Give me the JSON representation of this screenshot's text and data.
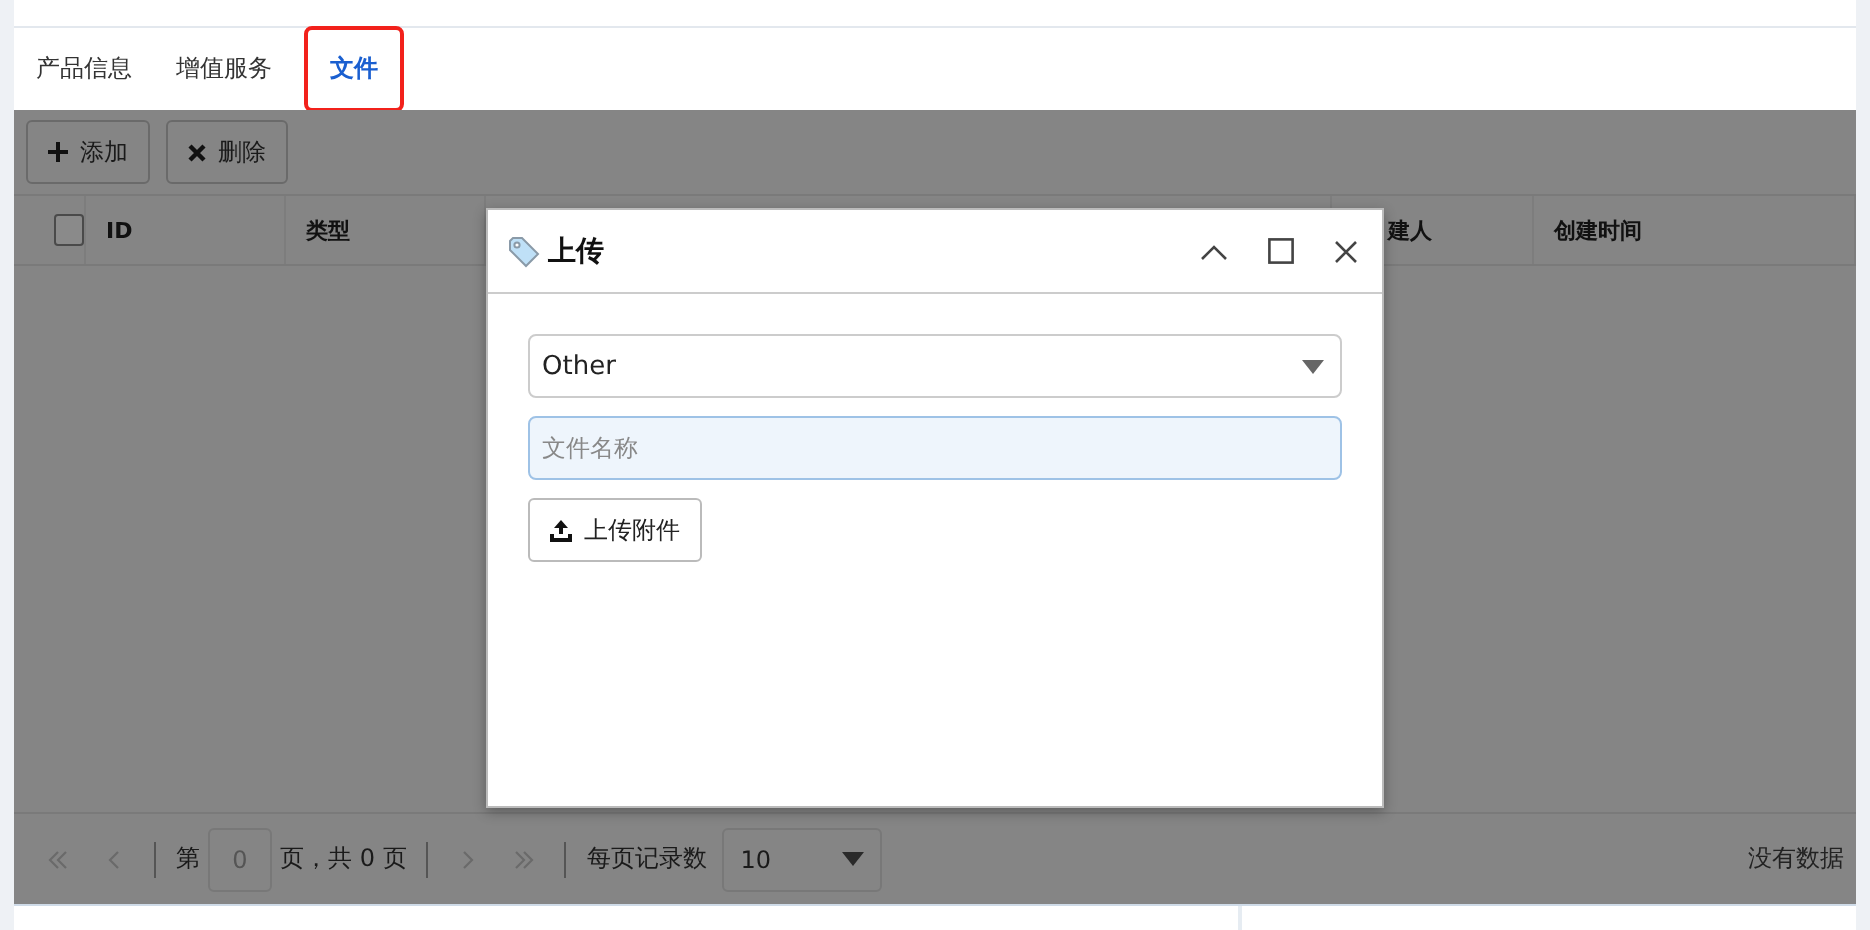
{
  "tabs": [
    {
      "label": "产品信息",
      "selected": false,
      "highlighted": false
    },
    {
      "label": "增值服务",
      "selected": false,
      "highlighted": false
    },
    {
      "label": "文件",
      "selected": true,
      "highlighted": true
    }
  ],
  "toolbar": [
    {
      "label": "添加",
      "kind": "add"
    },
    {
      "label": "删除",
      "kind": "delete"
    }
  ],
  "table": {
    "select_all": {
      "checked": false
    },
    "columns": [
      {
        "label": "ID",
        "kind": "id"
      },
      {
        "label": "类型",
        "kind": "type"
      },
      {
        "kind": "hidden"
      },
      {
        "label": "建人",
        "kind": "partial"
      },
      {
        "label": "创建时间",
        "kind": "time"
      }
    ]
  },
  "pager": {
    "page_prefix": "第",
    "page": "0",
    "page_suffix": "页，共 0 页",
    "page_size_label": "每页记录数",
    "page_size": "10",
    "empty_text": "没有数据"
  },
  "dialog": {
    "title": "上传",
    "type_value": "Other",
    "name_placeholder": "文件名称",
    "upload_button": "上传附件"
  }
}
